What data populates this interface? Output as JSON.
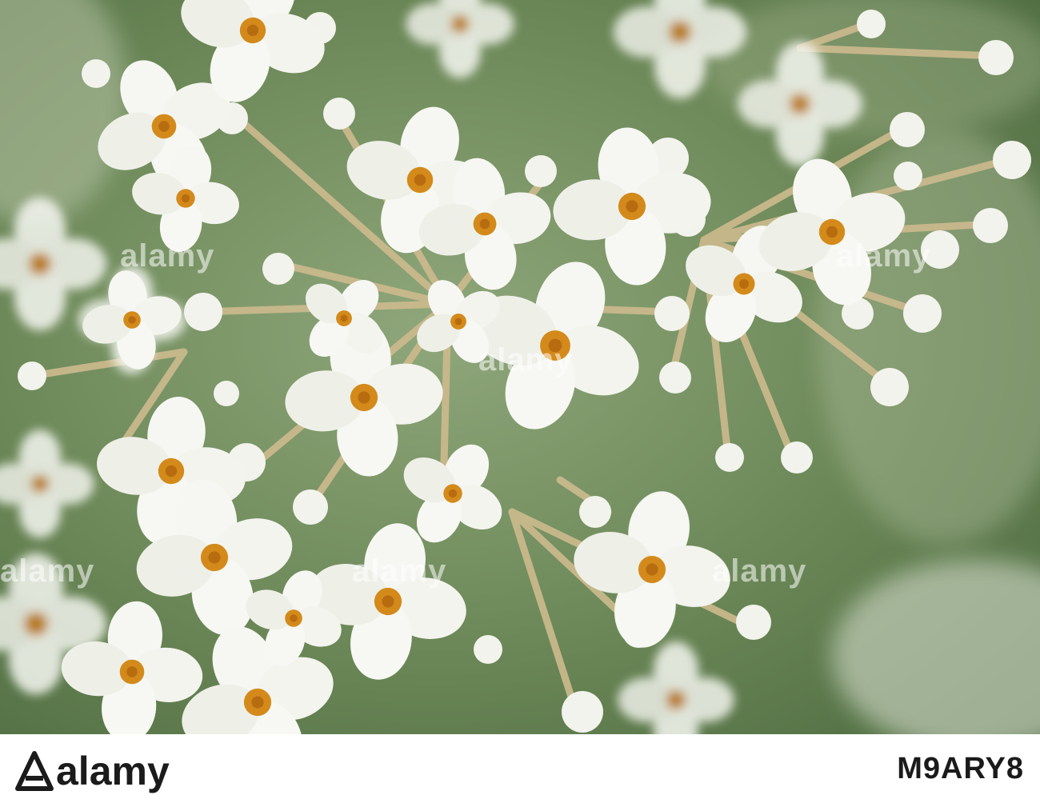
{
  "photo": {
    "subject": "white-flower-cluster"
  },
  "watermark": {
    "text": "alamy",
    "opacity": 0.55
  },
  "footer": {
    "logo_text": "alamy",
    "stock_id": "M9ARY8"
  },
  "colors": {
    "background_green": "#5d7a4e",
    "petal_white": "#f6f7f2",
    "flower_center": "#d48a1a",
    "stem_tan": "#c9b88c"
  }
}
